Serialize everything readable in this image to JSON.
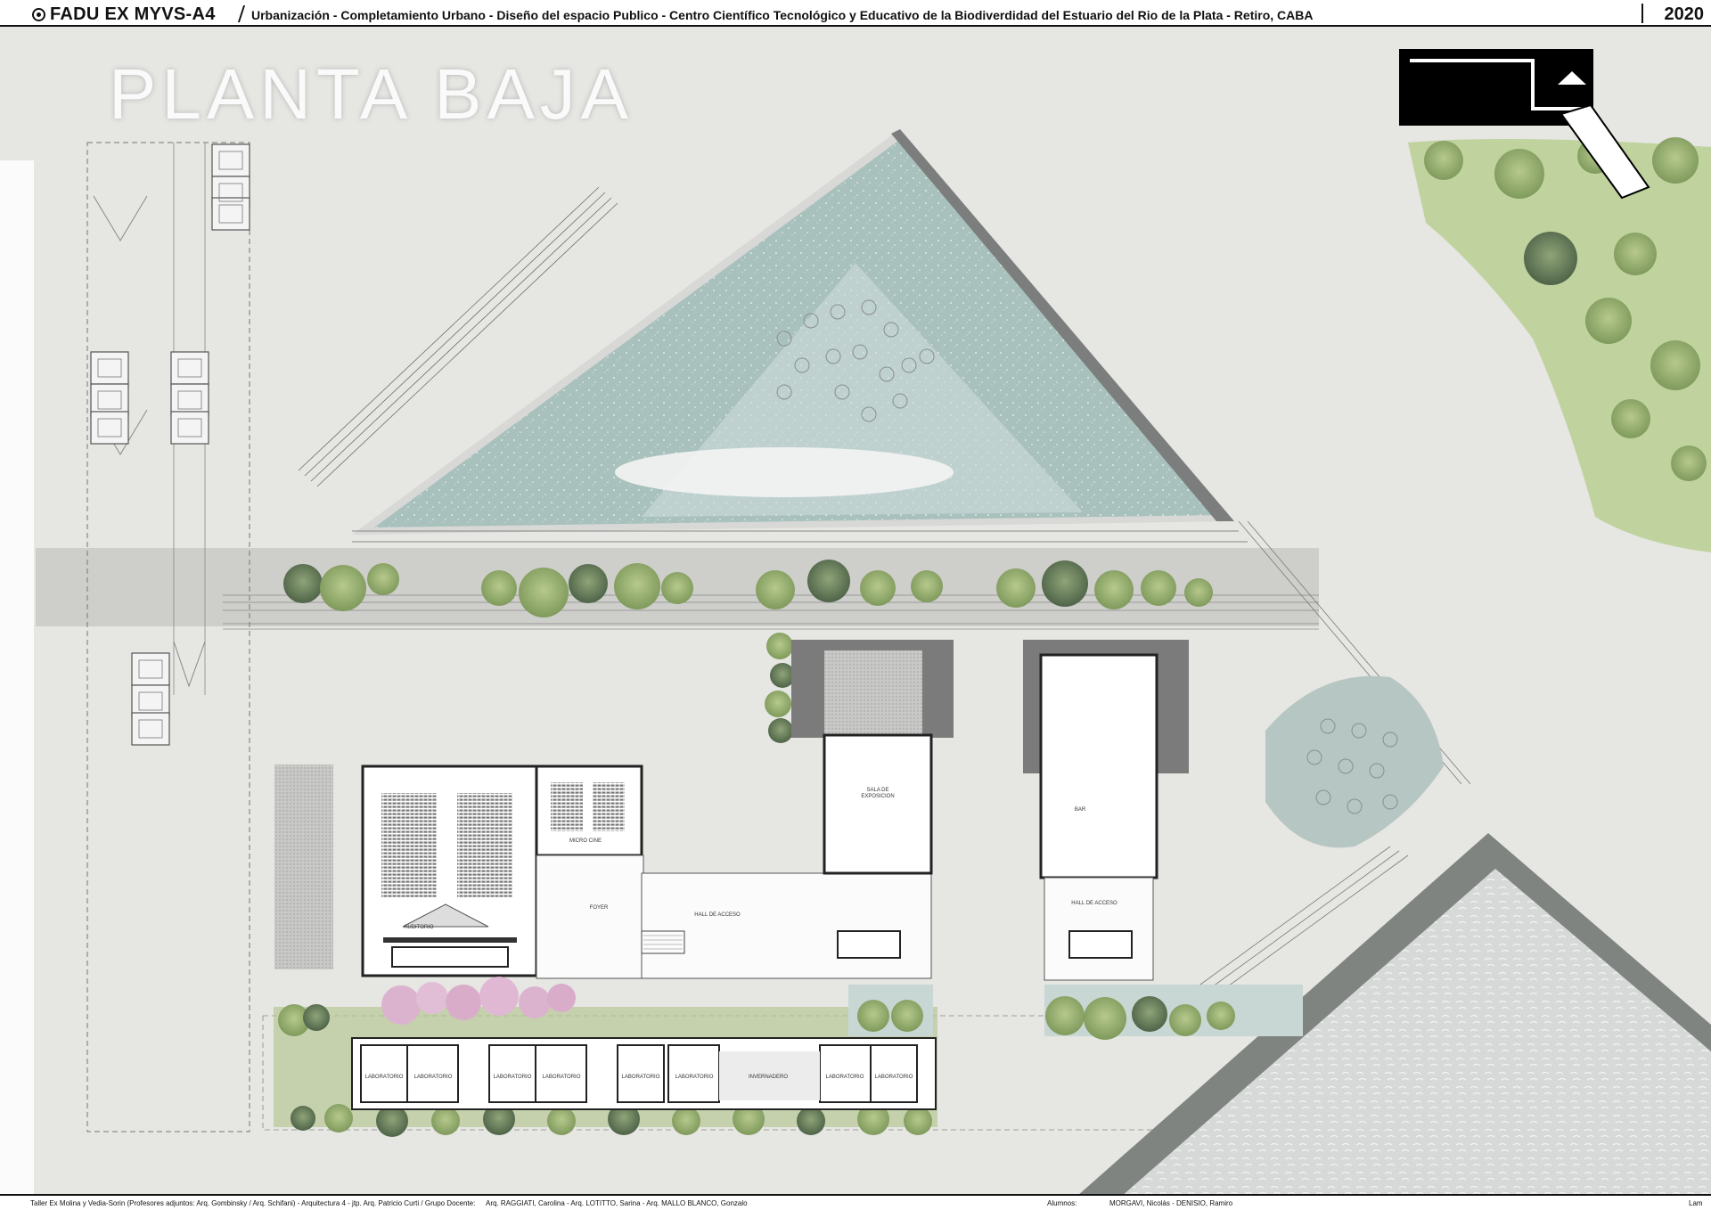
{
  "header": {
    "code": "FADU EX MYVS-A4",
    "description": "Urbanización - Completamiento Urbano - Diseño del espacio Publico - Centro Científico Tecnológico y Educativo de la Biodiverdidad del Estuario del Rio de la Plata   - Retiro, CABA",
    "year": "2020"
  },
  "title": "PLANTA BAJA",
  "rooms": {
    "auditorio": "AUDITORIO",
    "micro_cine": "MICRO CINE",
    "foyer": "FOYER",
    "hall_1": "HALL DE ACCESO",
    "hall_2": "HALL DE ACCESO",
    "sala_1": "SALA DE",
    "sala_2": "EXPOSICION",
    "bar": "BAR",
    "invernadero": "INVERNADERO",
    "laboratorio": "LABORATORIO"
  },
  "footer": {
    "credits": "Taller Ex Molina y Vedia-Sorin (Profesores adjuntos:  Arq. Gombinsky / Arq. Schifani) - Arquitectura 4 - jtp. Arq. Patricio Curti / Grupo Docente:",
    "docentes": "Arq. RAGGIATI, Carolina - Arq. LOTITTO, Sarina - Arq. MALLO BLANCO, Gonzalo",
    "alumnos_label": "Alumnos:",
    "alumnos": "MORGAVI, Nicolás - DENISIO, Ramiro",
    "sheet": "Lam"
  },
  "colors": {
    "pavement": "#e6e6e3",
    "water": "#9fb9b5",
    "dark_water": "#7e8d8a",
    "green": "#aac184",
    "tree": "#8da866",
    "pink": "#dcb3cf",
    "wall": "#222222"
  },
  "icons": {
    "logo": "university-seal-icon",
    "key_plan": "key-plan-icon"
  }
}
